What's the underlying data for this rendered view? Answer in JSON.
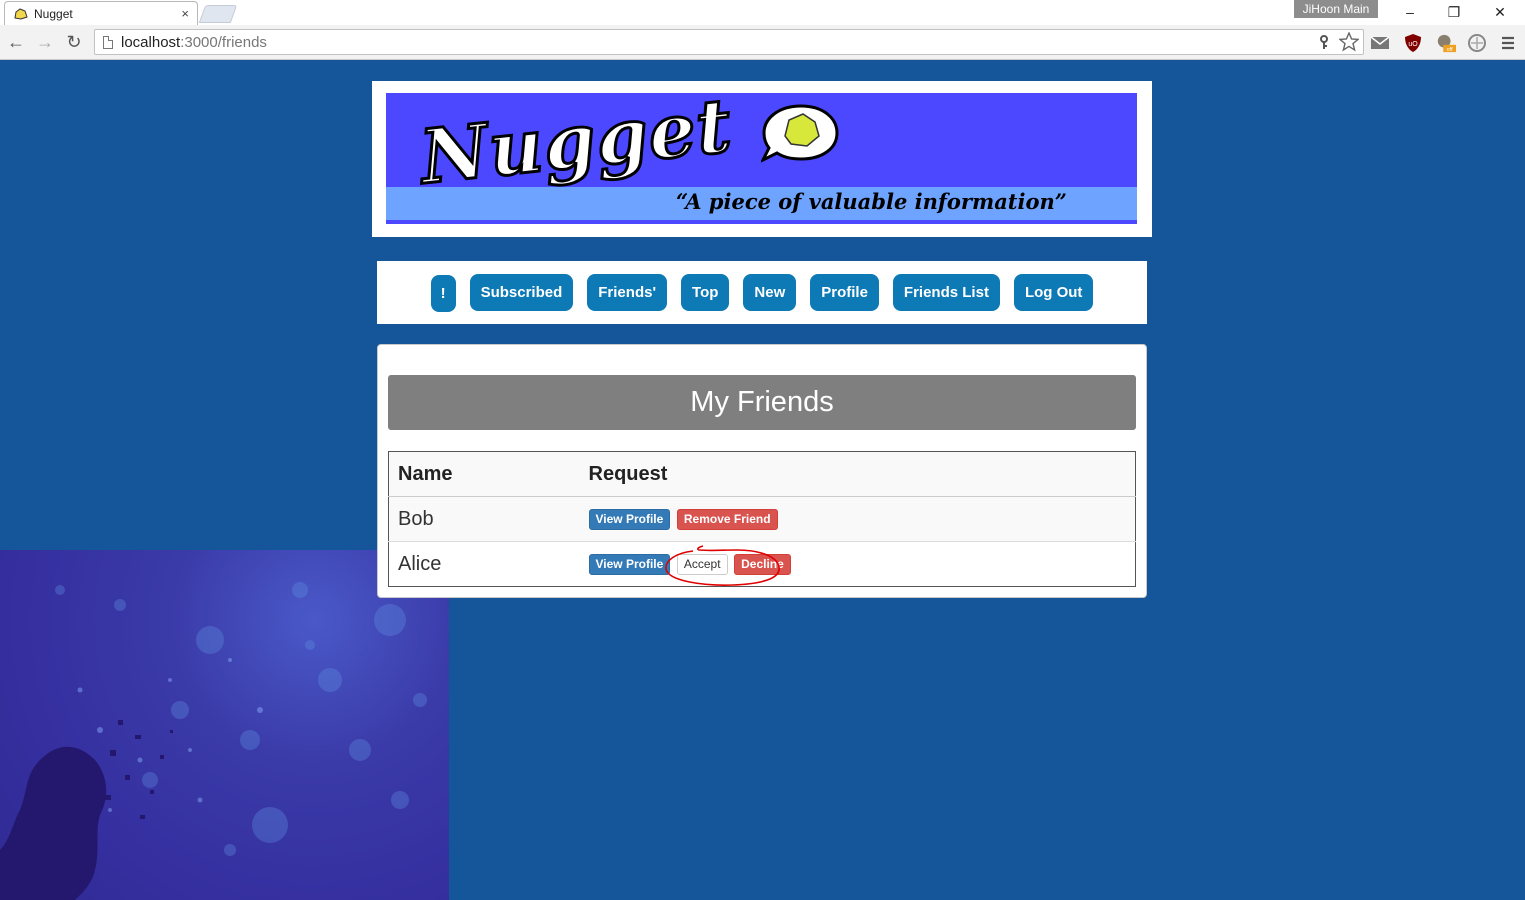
{
  "browser": {
    "tab_title": "Nugget",
    "tab_close": "×",
    "profile_name": "JiHoon Main",
    "url_host": "localhost",
    "url_rest": ":3000/friends",
    "window_controls": {
      "minimize": "–",
      "restore": "❐",
      "close": "✕"
    },
    "nav": {
      "back": "←",
      "forward": "→",
      "reload": "↻"
    },
    "extensions": [
      "key-icon",
      "star-icon",
      "mail-icon",
      "ublock-icon",
      "extension-off-icon",
      "privacy-icon",
      "menu-icon"
    ]
  },
  "banner": {
    "logo_text": "Nugget",
    "tagline": "“A piece of valuable information”"
  },
  "nav": {
    "alert": "!",
    "subscribed": "Subscribed",
    "friends": "Friends'",
    "top": "Top",
    "new": "New",
    "profile": "Profile",
    "friends_list": "Friends List",
    "logout": "Log Out"
  },
  "panel": {
    "title": "My Friends",
    "columns": [
      "Name",
      "Request"
    ],
    "rows": [
      {
        "name": "Bob",
        "view_label": "View Profile",
        "remove_label": "Remove Friend"
      },
      {
        "name": "Alice",
        "view_label": "View Profile",
        "accept_label": "Accept",
        "decline_label": "Decline"
      }
    ]
  },
  "colors": {
    "page_bg": "#15559a",
    "nav_button": "#0d7ab6",
    "banner_bg": "#4c48ff",
    "btn_primary": "#337ab7",
    "btn_danger": "#d9534f",
    "annotation": "#e00000"
  }
}
